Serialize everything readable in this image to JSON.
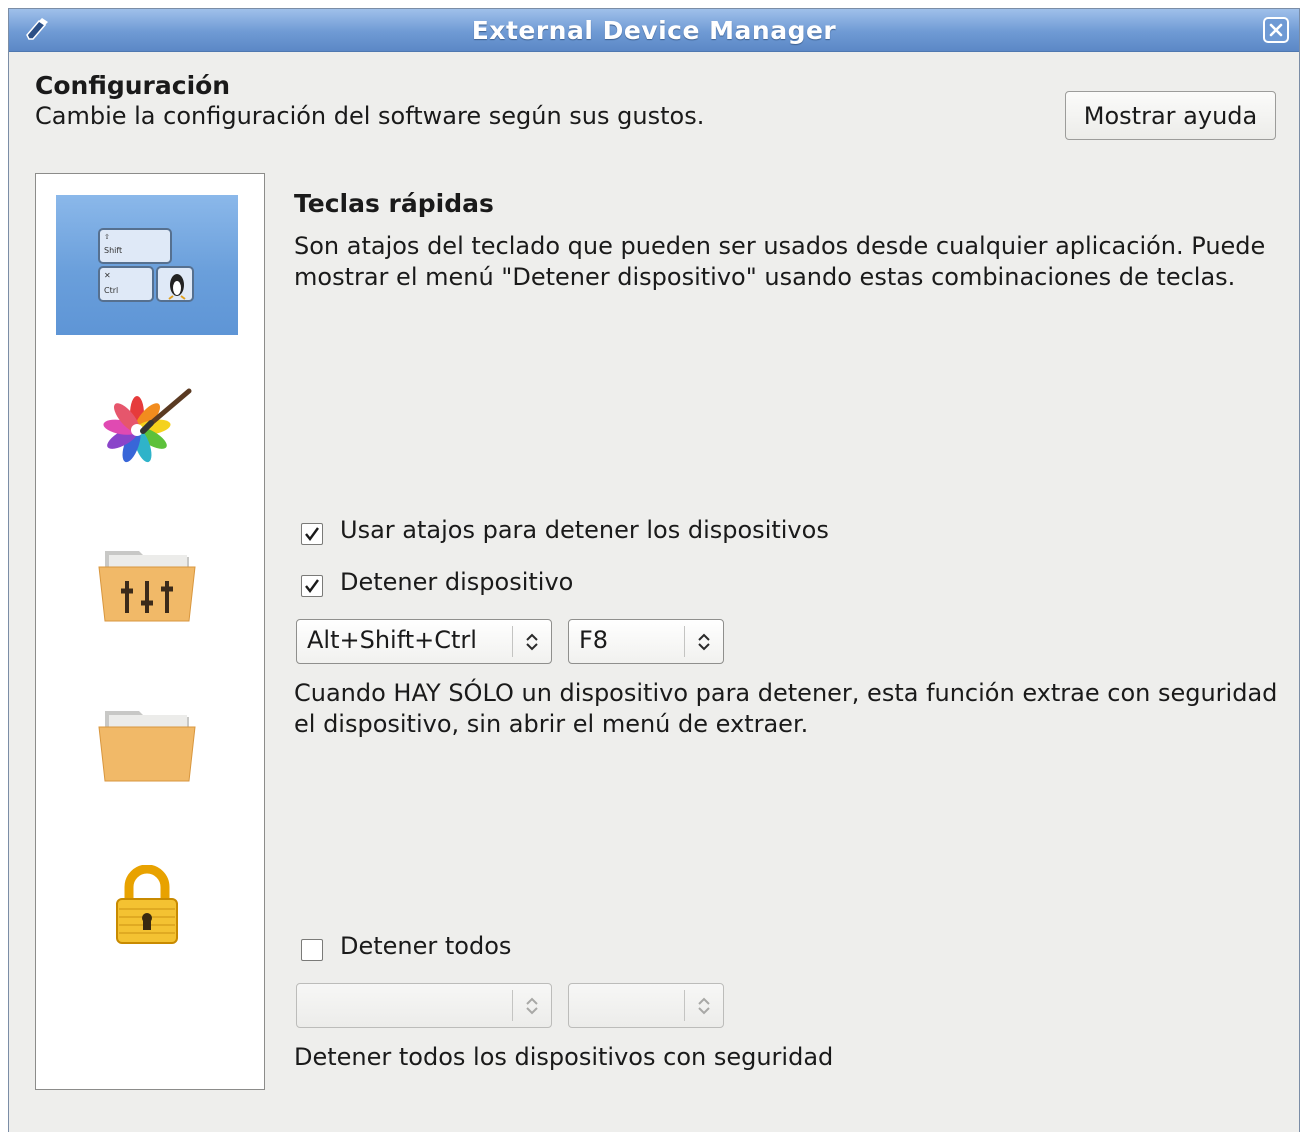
{
  "window": {
    "title": "External Device Manager"
  },
  "header": {
    "title": "Configuración",
    "subtitle": "Cambie la configuración del software según sus gustos.",
    "help_button": "Mostrar ayuda"
  },
  "sidebar": {
    "items": [
      {
        "icon": "keyboard-shortcuts-icon",
        "selected": true
      },
      {
        "icon": "appearance-palette-icon",
        "selected": false
      },
      {
        "icon": "folder-settings-icon",
        "selected": false
      },
      {
        "icon": "folder-icon",
        "selected": false
      },
      {
        "icon": "padlock-icon",
        "selected": false
      }
    ]
  },
  "panel": {
    "title": "Teclas rápidas",
    "description": "Son atajos del teclado que pueden ser usados desde cualquier aplicación. Puede mostrar el menú \"Detener dispositivo\" usando estas combinaciones de teclas.",
    "use_shortcuts": {
      "label": "Usar atajos para detener los dispositivos",
      "checked": true
    },
    "stop_device": {
      "label": "Detener dispositivo",
      "checked": true,
      "modifier": "Alt+Shift+Ctrl",
      "key": "F8",
      "note": "Cuando HAY SÓLO un dispositivo para detener, esta función extrae con seguridad el dispositivo, sin abrir el menú de extraer."
    },
    "stop_all": {
      "label": "Detener todos",
      "checked": false,
      "modifier": "",
      "key": "",
      "note": "Detener todos los dispositivos con seguridad"
    }
  },
  "colors": {
    "title_bar": "#6f9ad4",
    "selection": "#6a9fdb",
    "window_bg": "#eeeeec"
  }
}
